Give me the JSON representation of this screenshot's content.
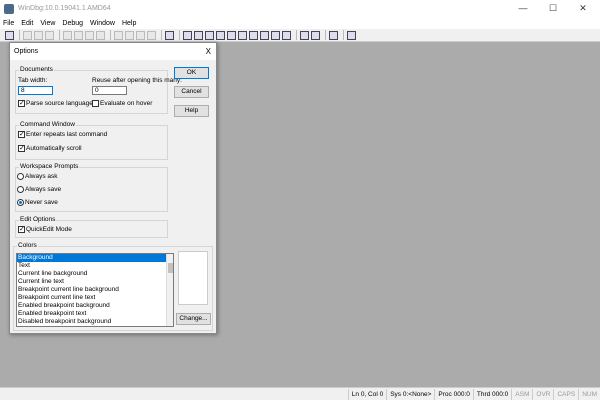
{
  "window": {
    "title": "WinDbg:10.0.19041.1 AMD64",
    "minimize": "—",
    "maximize": "☐",
    "close": "✕"
  },
  "menu": [
    "File",
    "Edit",
    "View",
    "Debug",
    "Window",
    "Help"
  ],
  "dialog": {
    "title": "Options",
    "close": "X",
    "documents": {
      "label": "Documents",
      "tab_width_label": "Tab width:",
      "tab_width_value": "8",
      "reuse_label": "Reuse after opening this many:",
      "reuse_value": "0",
      "parse_source": "Parse source languages",
      "parse_checked": true,
      "evaluate_hover": "Evaluate on hover",
      "evaluate_checked": false
    },
    "command_window": {
      "label": "Command Window",
      "enter_repeats": "Enter repeats last command",
      "auto_scroll": "Automatically scroll"
    },
    "workspace": {
      "label": "Workspace Prompts",
      "options": [
        "Always ask",
        "Always save",
        "Never save"
      ],
      "selected": "Never save"
    },
    "edit": {
      "label": "Edit Options",
      "quickedit": "QuickEdit Mode"
    },
    "colors": {
      "label": "Colors",
      "items": [
        "Background",
        "Text",
        "Current line background",
        "Current line text",
        "Breakpoint current line background",
        "Breakpoint current line text",
        "Enabled breakpoint background",
        "Enabled breakpoint text",
        "Disabled breakpoint background"
      ],
      "selected": "Background",
      "change": "Change..."
    },
    "buttons": {
      "ok": "OK",
      "cancel": "Cancel",
      "help": "Help"
    },
    "check": "✓"
  },
  "status": {
    "position": "Ln 0, Col 0",
    "sys": "Sys 0:<None>",
    "proc": "Proc 000:0",
    "thrd": "Thrd 000:0",
    "asm": "ASM",
    "ovr": "OVR",
    "caps": "CAPS",
    "num": "NUM"
  }
}
